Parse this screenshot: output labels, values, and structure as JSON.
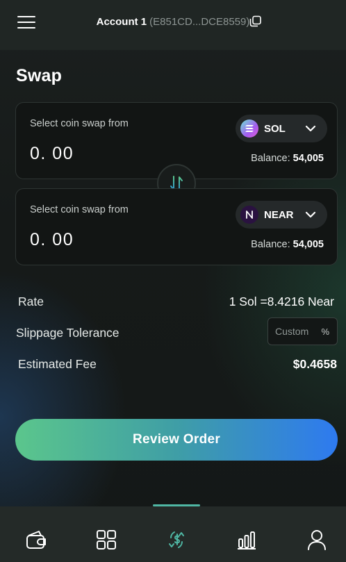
{
  "header": {
    "account_name": "Account 1",
    "account_address": "(E851CD...DCE8559)",
    "menu_icon": "hamburger-menu-icon",
    "copy_icon": "copy-icon"
  },
  "page": {
    "title": "Swap"
  },
  "from_card": {
    "label": "Select coin swap from",
    "amount": "0. 00",
    "coin": "SOL",
    "balance_label": "Balance:",
    "balance_value": "54,005"
  },
  "to_card": {
    "label": "Select coin swap from",
    "amount": "0. 00",
    "coin": "NEAR",
    "balance_label": "Balance:",
    "balance_value": "54,005"
  },
  "details": {
    "rate_label": "Rate",
    "rate_value": "1 Sol =8.4216 Near",
    "slippage_label": "Slippage Tolerance",
    "slippage_placeholder": "Custom",
    "slippage_unit": "%",
    "fee_label": "Estimated Fee",
    "fee_value": "$0.4658"
  },
  "actions": {
    "review_label": "Review Order"
  },
  "nav": {
    "items": [
      {
        "icon": "wallet-icon"
      },
      {
        "icon": "grid-icon"
      },
      {
        "icon": "swap-dollar-icon",
        "active": true
      },
      {
        "icon": "bar-chart-icon"
      },
      {
        "icon": "user-icon"
      }
    ]
  },
  "colors": {
    "accent_green": "#5bc68c",
    "accent_blue": "#2e7af0",
    "active_nav": "#4fb7a4"
  }
}
